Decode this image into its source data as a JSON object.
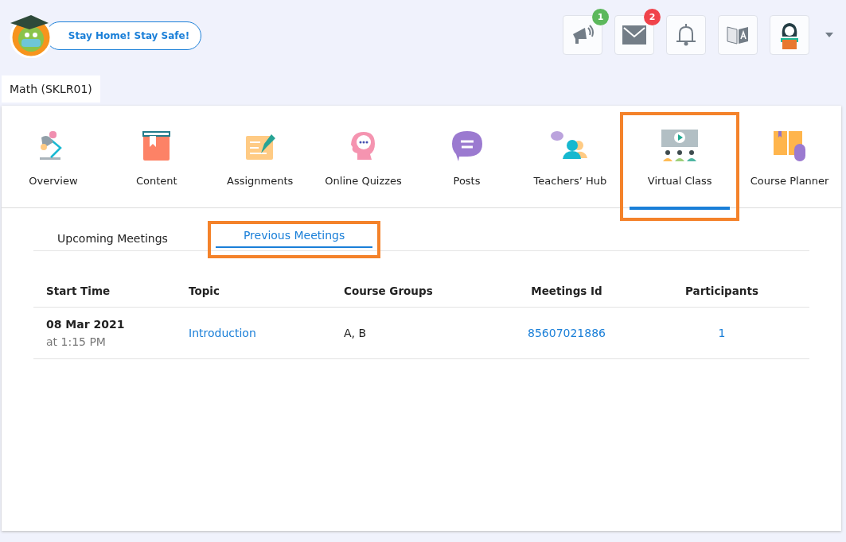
{
  "banner": {
    "label": "Stay Home! Stay Safe!"
  },
  "header_icons": [
    {
      "kind": "megaphone",
      "badge": "1",
      "color": "#5cb85c"
    },
    {
      "kind": "mail",
      "badge": "2",
      "color": "#f0434b"
    },
    {
      "kind": "bell"
    },
    {
      "kind": "translate"
    },
    {
      "kind": "avatar"
    }
  ],
  "course": {
    "title": "Math (SKLR01)"
  },
  "tabs": [
    {
      "kind": "lamp",
      "label": "Overview",
      "selected": false,
      "highlighted": false
    },
    {
      "kind": "book",
      "label": "Content",
      "selected": false,
      "highlighted": false
    },
    {
      "kind": "pen",
      "label": "Assignments",
      "selected": false,
      "highlighted": false
    },
    {
      "kind": "head",
      "label": "Online Quizzes",
      "selected": false,
      "highlighted": false
    },
    {
      "kind": "chat",
      "label": "Posts",
      "selected": false,
      "highlighted": false
    },
    {
      "kind": "people",
      "label": "Teachers’ Hub",
      "selected": false,
      "highlighted": false
    },
    {
      "kind": "screen",
      "label": "Virtual Class",
      "selected": true,
      "highlighted": true
    },
    {
      "kind": "planner",
      "label": "Course Planner",
      "selected": false,
      "highlighted": false
    }
  ],
  "subtabs": [
    {
      "label": "Upcoming Meetings",
      "selected": false,
      "highlighted": false
    },
    {
      "label": "Previous Meetings",
      "selected": true,
      "highlighted": true
    }
  ],
  "table": {
    "columns": [
      "Start Time",
      "Topic",
      "Course Groups",
      "Meetings Id",
      "Participants"
    ],
    "rows": [
      {
        "date": "08 Mar 2021",
        "time": "at 1:15 PM",
        "topic": "Introduction",
        "groups": "A, B",
        "meeting_id": "85607021886",
        "participants": "1"
      }
    ]
  }
}
